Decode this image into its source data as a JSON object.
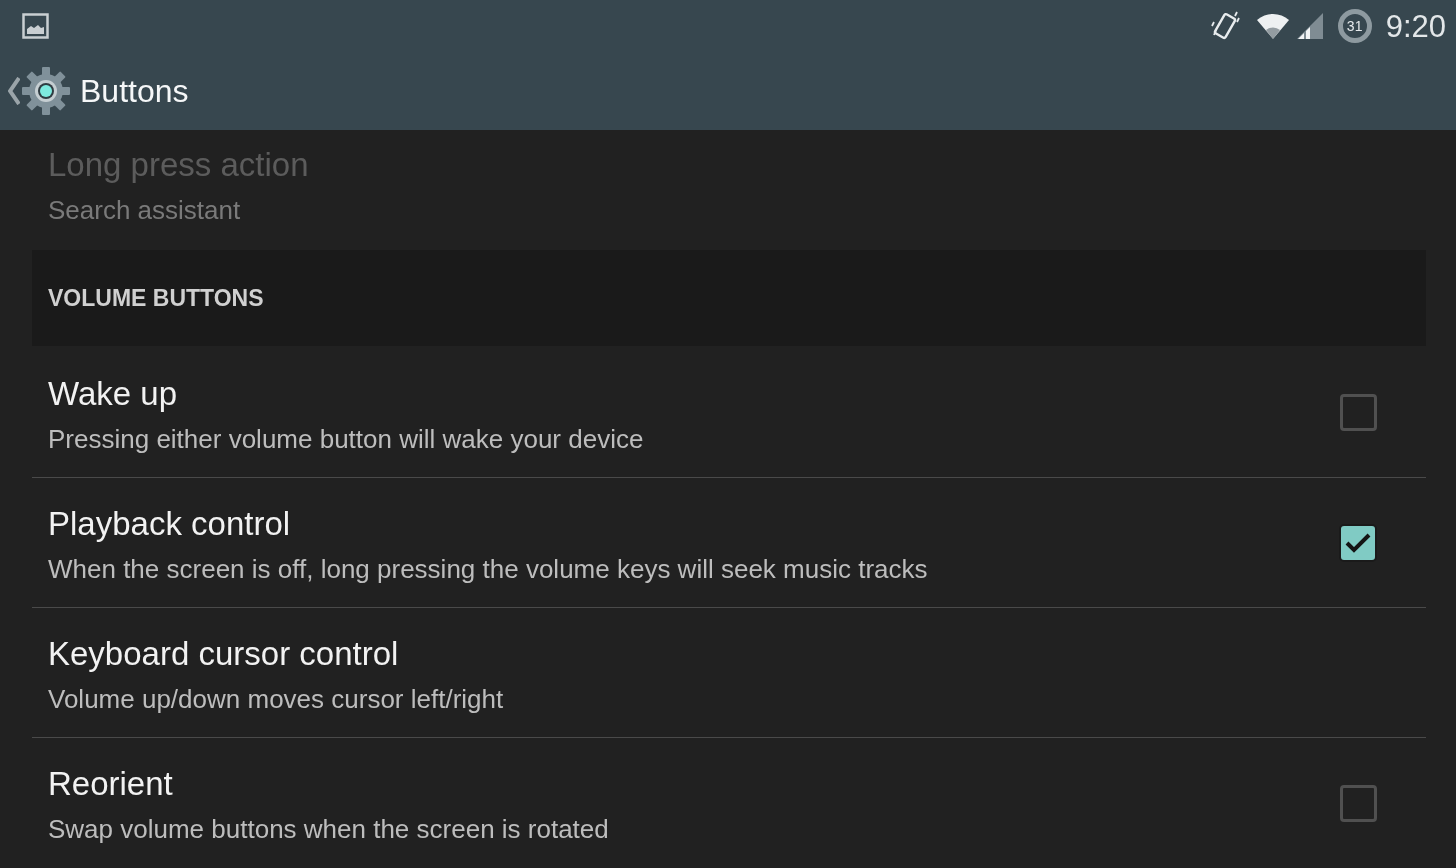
{
  "status_bar": {
    "battery_text": "31",
    "time": "9:20"
  },
  "action_bar": {
    "title": "Buttons"
  },
  "top_item": {
    "title": "Long press action",
    "summary": "Search assistant",
    "disabled": true
  },
  "sections": [
    {
      "header": "VOLUME BUTTONS",
      "items": [
        {
          "kind": "checkbox",
          "title": "Wake up",
          "summary": "Pressing either volume button will wake your device",
          "checked": false
        },
        {
          "kind": "checkbox",
          "title": "Playback control",
          "summary": "When the screen is off, long pressing the volume keys will seek music tracks",
          "checked": true
        },
        {
          "kind": "list",
          "title": "Keyboard cursor control",
          "summary": "Volume up/down moves cursor left/right"
        },
        {
          "kind": "checkbox",
          "title": "Reorient",
          "summary": "Swap volume buttons when the screen is rotated",
          "checked": false
        }
      ]
    }
  ]
}
